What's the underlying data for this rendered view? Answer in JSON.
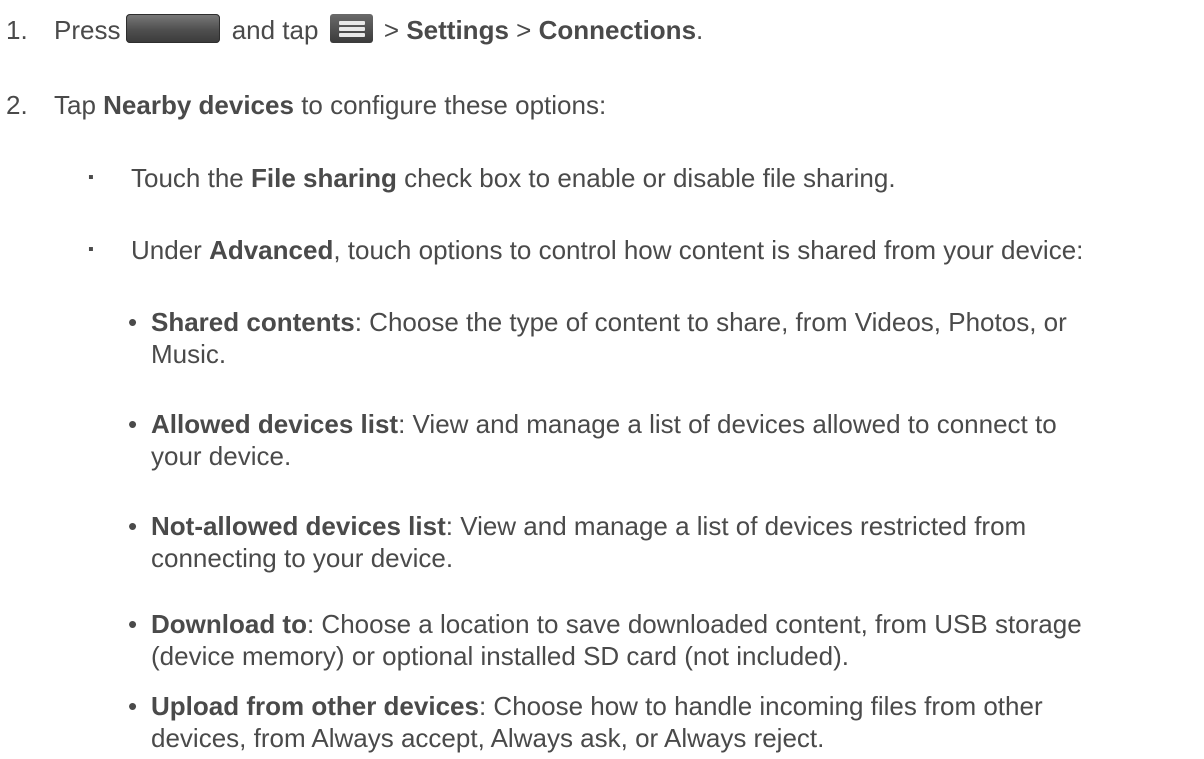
{
  "steps": [
    {
      "number": "1.",
      "t1": "Press",
      "t2": "and tap",
      "t3": ">",
      "b1": "Settings",
      "t4": ">",
      "b2": "Connections",
      "t5": "."
    },
    {
      "number": "2.",
      "t1": "Tap",
      "b1": "Nearby devices",
      "t2": "to configure these options:"
    }
  ],
  "icons": {
    "home_key": "home-key-icon",
    "menu_key": "menu-key-icon"
  },
  "bullets": [
    {
      "marker": "▪",
      "t1": "Touch the",
      "b1": "File sharing",
      "t2": "check box to enable or disable file sharing."
    },
    {
      "marker": "▪",
      "t1": "Under",
      "b1": "Advanced",
      "t2": ", touch options to control how content is shared from your device:"
    }
  ],
  "subitems": [
    {
      "marker": "•",
      "term": "Shared contents",
      "line1": ": Choose the type of content to share, from Videos, Photos, or",
      "line2": "Music."
    },
    {
      "marker": "•",
      "term": "Allowed devices list",
      "line1": ": View and manage a list of devices allowed to connect to",
      "line2": "your device."
    },
    {
      "marker": "•",
      "term": "Not-allowed devices list",
      "line1": ": View and manage a list of devices restricted from",
      "line2": "connecting to your device."
    },
    {
      "marker": "•",
      "term": "Download to",
      "line1": ": Choose a location to save downloaded content, from USB storage",
      "line2": "(device memory) or optional installed SD card (not included)."
    },
    {
      "marker": "•",
      "term": "Upload from other devices",
      "line1": ": Choose how to handle incoming files from other",
      "line2": "devices, from Always accept, Always ask, or Always reject."
    }
  ]
}
